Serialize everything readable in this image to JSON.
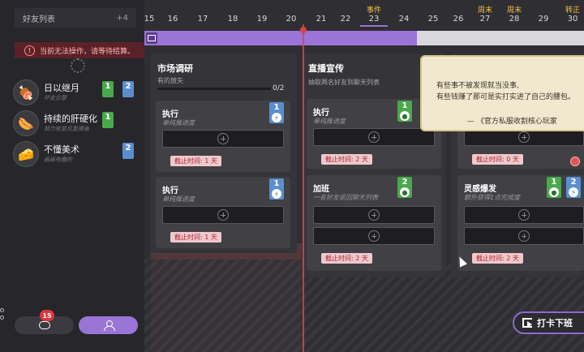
{
  "sidebar": {
    "header_label": "好友列表",
    "header_count": "+4",
    "warning_text": "当前无法操作，请等待结算。",
    "friends": [
      {
        "name": "日以继月",
        "sub": "坏变忘孽",
        "avatar": "meat-icon",
        "badges": [
          {
            "value": "1",
            "color": "green"
          },
          {
            "value": "2",
            "color": "blue"
          }
        ]
      },
      {
        "name": "持续的肝硬化",
        "sub": "努力就是反复摸鱼",
        "avatar": "sausage-icon",
        "badges": [
          {
            "value": "1",
            "color": "green"
          }
        ]
      },
      {
        "name": "不懂美术",
        "sub": "画画有趣的",
        "avatar": "cheese-icon",
        "badges": [
          {
            "value": "2",
            "color": "blue"
          }
        ]
      }
    ],
    "chat_badge": "15"
  },
  "timeline": {
    "days": [
      "15",
      "16",
      "17",
      "18",
      "19",
      "20",
      "21",
      "22",
      "23",
      "24",
      "25",
      "26",
      "27",
      "28",
      "29",
      "30"
    ],
    "labels": [
      {
        "day": "23",
        "text": "事件"
      },
      {
        "day": "27",
        "text": "周末"
      },
      {
        "day": "28",
        "text": "周末"
      },
      {
        "day": "30",
        "text": "转正"
      }
    ],
    "progress_fraction": 0.62
  },
  "columns": [
    {
      "title": "市场调研",
      "subtitle": "有的放矢",
      "progress_text": "0/2",
      "cards": [
        {
          "title": "执行",
          "desc": "单纯推进度",
          "req": [
            {
              "value": "1",
              "color": "blue",
              "icon": "lightning-icon"
            }
          ],
          "deadline": "截止时间: 1 天"
        },
        {
          "title": "执行",
          "desc": "单纯推进度",
          "req": [
            {
              "value": "1",
              "color": "blue",
              "icon": "lightning-icon"
            }
          ],
          "deadline": "截止时间: 1 天"
        }
      ]
    },
    {
      "title": "直播宣传",
      "subtitle": "抽取两名好友到聊天列表",
      "cards": [
        {
          "title": "执行",
          "desc": "单纯推进度",
          "req": [
            {
              "value": "1",
              "color": "green",
              "icon": "palette-icon"
            }
          ],
          "deadline": "截止时间: 2 天"
        },
        {
          "title": "加班",
          "desc": "一名好友返回聊天列表",
          "req": [
            {
              "value": "2",
              "color": "green",
              "icon": "palette-icon"
            }
          ],
          "deadline": "截止时间: 2 天"
        }
      ]
    },
    {
      "cards": [
        {
          "deadline": "截止时间: 0 天"
        },
        {
          "title": "灵感爆发",
          "desc": "额外获得1点完成度",
          "req": [
            {
              "value": "1",
              "color": "green",
              "icon": "palette-icon"
            },
            {
              "value": "2",
              "color": "blue",
              "icon": "lightning-icon"
            }
          ],
          "deadline": "截止时间: 2 天"
        }
      ]
    }
  ],
  "quote": {
    "line1": "有些事不被发现就当没事,",
    "line2": "有些钱赚了那可是实打实进了自己的腰包。",
    "author": "— 《官方私服收割核心玩家"
  },
  "checkin_button": "打卡下班",
  "colors": {
    "accent": "#9a74d6",
    "green": "#4aa84d",
    "blue": "#5a8fcf",
    "danger": "#d9434a"
  }
}
